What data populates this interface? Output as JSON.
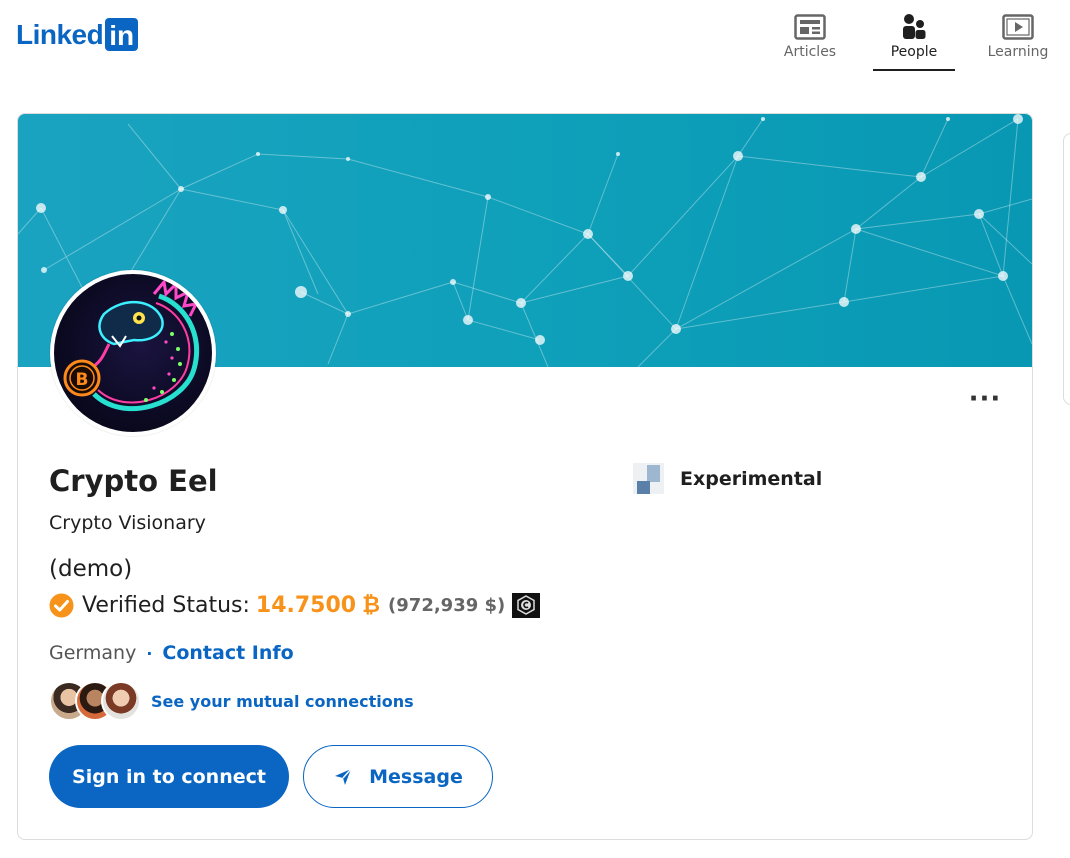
{
  "brand": {
    "logo_text": "Linked",
    "logo_box": "in",
    "color": "#0a66c2"
  },
  "nav": {
    "items": [
      {
        "label": "Articles",
        "icon": "articles-icon",
        "active": false
      },
      {
        "label": "People",
        "icon": "people-icon",
        "active": true
      },
      {
        "label": "Learning",
        "icon": "learning-icon",
        "active": false
      }
    ]
  },
  "profile": {
    "name": "Crypto Eel",
    "headline": "Crypto Visionary",
    "note": "(demo)",
    "verified": {
      "label": "Verified Status:",
      "amount": "14.7500",
      "currency_symbol": "₿",
      "usd": "(972,939 $)",
      "amount_color": "#f7931a"
    },
    "location": "Germany",
    "separator": "·",
    "contact_info": "Contact Info",
    "mutual_connections": "See your mutual connections",
    "company": "Experimental"
  },
  "actions": {
    "connect": "Sign in to connect",
    "message": "Message",
    "more": "···"
  },
  "colors": {
    "banner": "#0fa0ba",
    "link": "#0a66c2"
  }
}
